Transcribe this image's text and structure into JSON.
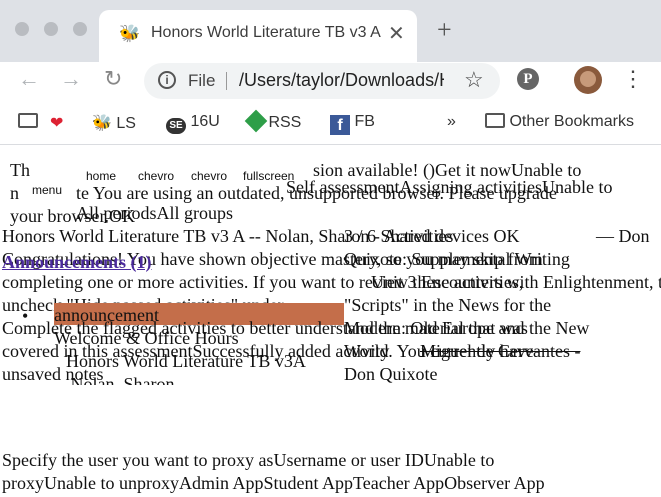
{
  "browser": {
    "tab": {
      "title": "Honors World Literature TB v3 A -- Nolan",
      "favicon": "bee-icon"
    },
    "new_tab_label": "+",
    "address": {
      "scheme": "File",
      "url": "/Users/taylor/Downloads/Honors World Literature"
    },
    "bookmarks": [
      {
        "label": "",
        "icon": "folder-icon"
      },
      {
        "label": "",
        "icon": "heart-icon"
      },
      {
        "label": "LS",
        "icon": "bee-icon"
      },
      {
        "label": "16U",
        "icon": "se-icon"
      },
      {
        "label": "RSS",
        "icon": "rss-icon"
      },
      {
        "label": "FB",
        "icon": "facebook-icon"
      }
    ],
    "overflow": "»",
    "other_bookmarks": "Other Bookmarks"
  },
  "page": {
    "line1_left": "Th",
    "nav_home": "home",
    "nav_chevron1": "chevro",
    "nav_chevron2": "chevro",
    "nav_fullscreen": "fullscreen",
    "line1_right": "sion available! ()Get it nowUnable to",
    "menu": "menu",
    "line2_a": "n",
    "line2_b": "te You are using an outdated, unsupported browser. Please upgrade",
    "self_assess": "Self assessmentAssigning activitiesUnable to",
    "line3": "your browser.OK",
    "periods": "All periodsAll groups",
    "title_line": "Honors World Literature TB v3 A -- Nolan, Sharon - Activities",
    "shared_ok": "3 / 6 Shared devices OK",
    "congrats": "Congratulations! You have shown objective mastery, so you may skip from",
    "don": "— Don",
    "announcements_label": "Announcements (1)",
    "quixote1": "Quixote: Supplemental Writing",
    "activities_line": "completing one or more activities. If you want to review these activities,",
    "unit3": "Unit 3 Encounters with Enlightenment, the exotic, and",
    "uncheck_line": "uncheck \"Hide passed activities\" under",
    "scripts_line": "\"Scripts\" in the News for the",
    "modern": "Modern: Old Europe and the New",
    "world": "World",
    "announcement": "announcement",
    "complete_line": "Complete the flagged activities to better understand the material that was",
    "welcome": "Welcome & Office Hours",
    "covered_line": "covered in this assessmentSuccessfully added activity. You currently have",
    "honors_item": "Honors World Literature TB v3A",
    "unsaved": "unsaved notes",
    "miguel": "Miguel de Cervantes -",
    "nolan": "-- Nolan, Sharon",
    "don_quixote": "Don Quixote",
    "proxy1": "Specify the user you want to proxy asUsername or user IDUnable to",
    "proxy2": "proxyUnable to unproxyAdmin AppStudent AppTeacher AppObserver App"
  }
}
